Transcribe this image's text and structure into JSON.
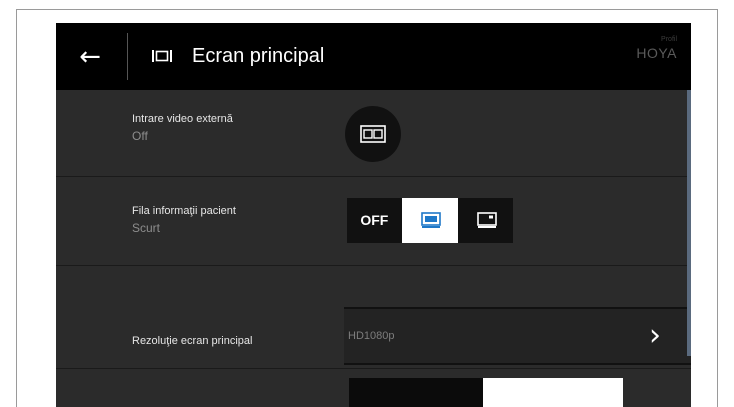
{
  "header": {
    "back_icon": "arrow-left-icon",
    "title_icon": "monitor-icon",
    "title": "Ecran principal",
    "brand_profile": "Profil",
    "brand_name": "HOYA"
  },
  "settings": [
    {
      "label": "Intrare video externă",
      "value": "Off",
      "control_icon": "dual-screen-icon"
    },
    {
      "label": "Fila informaţii pacient",
      "value": "Scurt",
      "options": [
        {
          "label": "OFF",
          "selected": false
        },
        {
          "icon": "patient-info-short-icon",
          "selected": true
        },
        {
          "icon": "patient-info-full-icon",
          "selected": false
        }
      ]
    },
    {
      "label": "Rezoluţie ecran principal",
      "value": "HD1080p",
      "chevron_icon": "chevron-right-icon"
    }
  ],
  "colors": {
    "selected": "#ffffff",
    "background": "#2b2b2b",
    "header": "#000000",
    "scrollbar": "#5a6a7e"
  }
}
